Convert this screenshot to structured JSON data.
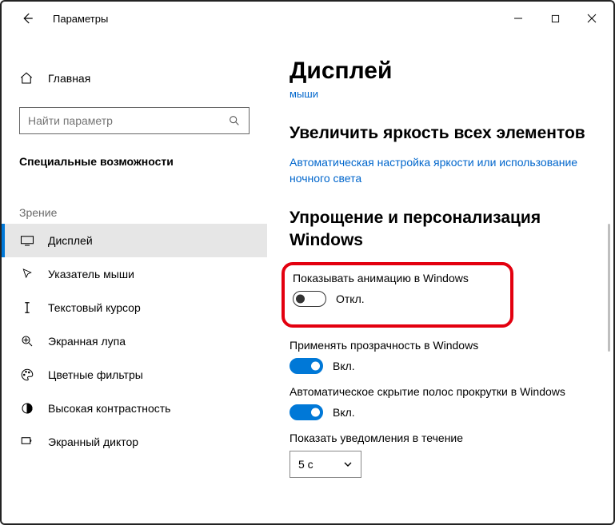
{
  "titlebar": {
    "title": "Параметры"
  },
  "sidebar": {
    "home": "Главная",
    "search_placeholder": "Найти параметр",
    "section": "Специальные возможности",
    "category": "Зрение",
    "items": [
      {
        "label": "Дисплей"
      },
      {
        "label": "Указатель мыши"
      },
      {
        "label": "Текстовый курсор"
      },
      {
        "label": "Экранная лупа"
      },
      {
        "label": "Цветные фильтры"
      },
      {
        "label": "Высокая контрастность"
      },
      {
        "label": "Экранный диктор"
      }
    ]
  },
  "content": {
    "page_title": "Дисплей",
    "partial": "мыши",
    "h_brightness": "Увеличить яркость всех элементов",
    "link_brightness": "Автоматическая настройка яркости или использование ночного света",
    "h_simplify": "Упрощение и персонализация Windows",
    "settings": {
      "anim": {
        "label": "Показывать анимацию в Windows",
        "state": "Откл."
      },
      "trans": {
        "label": "Применять прозрачность в Windows",
        "state": "Вкл."
      },
      "scroll": {
        "label": "Автоматическое скрытие полос прокрутки в Windows",
        "state": "Вкл."
      },
      "notif": {
        "label": "Показать уведомления в течение",
        "value": "5 с"
      }
    }
  }
}
